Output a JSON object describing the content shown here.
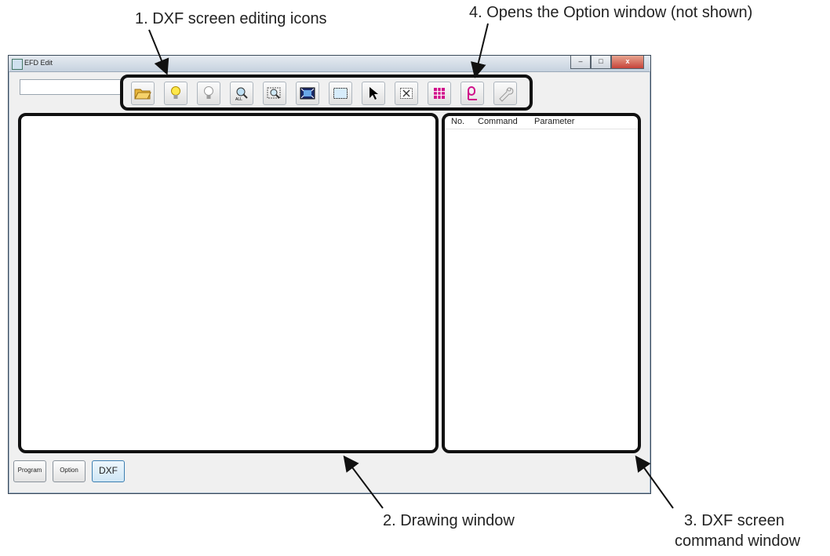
{
  "callouts": {
    "c1": "1. DXF screen editing icons",
    "c4": "4. Opens the Option window (not shown)",
    "c2": "2. Drawing window",
    "c3_line1": "3. DXF screen",
    "c3_line2": "command window"
  },
  "window": {
    "title": "EFD Edit",
    "controls": {
      "minimize": "–",
      "maximize": "□",
      "close": "x"
    }
  },
  "toolbar": {
    "icons": [
      "open-folder-icon",
      "bulb-on-icon",
      "bulb-off-icon",
      "zoom-all-icon",
      "zoom-window-icon",
      "fit-view-icon",
      "select-rect-icon",
      "pointer-icon",
      "delete-box-icon",
      "grid-icon",
      "loop-icon",
      "wrench-icon"
    ]
  },
  "command_window": {
    "columns": [
      "No.",
      "Command",
      "Parameter"
    ]
  },
  "bottom_buttons": [
    "Program",
    "Option",
    "DXF"
  ],
  "colors": {
    "highlight_border": "#111111",
    "titlebar": "#c6d2df",
    "close_button": "#c7443a",
    "grid_icon": "#d0108a",
    "active_tab": "#cfe6f5"
  }
}
